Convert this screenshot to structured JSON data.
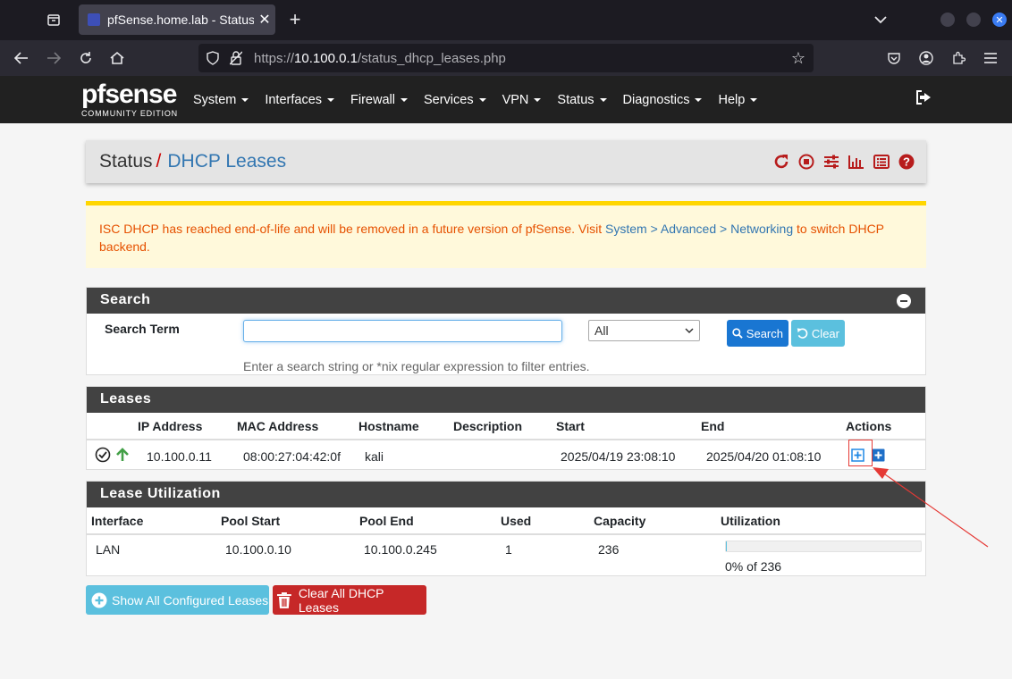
{
  "browser": {
    "tab_title": "pfSense.home.lab - Status: DHCP Leases",
    "url_prefix": "https://",
    "url_host": "10.100.0.1",
    "url_path": "/status_dhcp_leases.php"
  },
  "header": {
    "logo_text": "pfsense",
    "logo_sub": "COMMUNITY EDITION",
    "menu": [
      "System",
      "Interfaces",
      "Firewall",
      "Services",
      "VPN",
      "Status",
      "Diagnostics",
      "Help"
    ]
  },
  "breadcrumb": {
    "section": "Status",
    "separator": "/",
    "page": "DHCP Leases"
  },
  "alert": {
    "text_before": "ISC DHCP has reached end-of-life and will be removed in a future version of pfSense. Visit ",
    "link": "System > Advanced > Networking",
    "text_after": " to switch DHCP backend."
  },
  "search": {
    "title": "Search",
    "label": "Search Term",
    "value": "",
    "select_value": "All",
    "search_button": "Search",
    "clear_button": "Clear",
    "help": "Enter a search string or *nix regular expression to filter entries."
  },
  "leases": {
    "title": "Leases",
    "columns": [
      "IP Address",
      "MAC Address",
      "Hostname",
      "Description",
      "Start",
      "End",
      "Actions"
    ],
    "rows": [
      {
        "ip": "10.100.0.11",
        "mac": "08:00:27:04:42:0f",
        "hostname": "kali",
        "description": "",
        "start": "2025/04/19 23:08:10",
        "end": "2025/04/20 01:08:10"
      }
    ]
  },
  "utilization": {
    "title": "Lease Utilization",
    "columns": [
      "Interface",
      "Pool Start",
      "Pool End",
      "Used",
      "Capacity",
      "Utilization"
    ],
    "rows": [
      {
        "interface": "LAN",
        "pool_start": "10.100.0.10",
        "pool_end": "10.100.0.245",
        "used": "1",
        "capacity": "236",
        "utilization_text": "0% of 236",
        "utilization_fraction": 0.004
      }
    ]
  },
  "buttons": {
    "show_all": "Show All Configured Leases",
    "clear_all": "Clear All DHCP Leases"
  },
  "colors": {
    "header_bg": "#212121",
    "link": "#3276b1",
    "danger": "#c62828",
    "info": "#5bc0de",
    "primary": "#1976d2",
    "alert_text": "#e65100"
  }
}
